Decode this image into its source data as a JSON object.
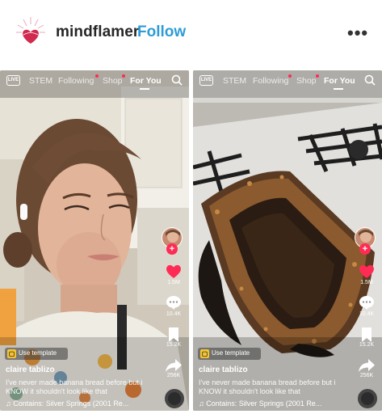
{
  "post": {
    "username": "mindflamer",
    "follow_label": "Follow",
    "more_label": "•••",
    "avatar_icon": "heart-lotus-logo-icon"
  },
  "videos": [
    {
      "live_label": "LIVE",
      "nav": [
        "STEM",
        "Following",
        "Shop",
        "For You"
      ],
      "active_tab": "For You",
      "creator": "claire tablizo",
      "caption": "I've never made banana bread before but i KNOW it shouldn't look like that",
      "music": "♫ Contains: Silver Springs (2001 Re...",
      "template_label": "Use template",
      "counts": {
        "likes": "1.5M",
        "comments": "10.4K",
        "saves": "15.2K",
        "shares": "256K"
      }
    },
    {
      "live_label": "LIVE",
      "nav": [
        "STEM",
        "Following",
        "Shop",
        "For You"
      ],
      "active_tab": "For You",
      "creator": "claire tablizo",
      "caption": "I've never made banana bread before but i KNOW it shouldn't look like that",
      "music": "♫ Contains: Silver Springs (2001 Re...",
      "template_label": "Use template",
      "counts": {
        "likes": "1.5M",
        "comments": "10.4K",
        "saves": "15.2K",
        "shares": "256K"
      }
    }
  ],
  "colors": {
    "follow": "#2e9cd6",
    "like": "#ff2b54",
    "accent_dot": "#ff2b54"
  }
}
